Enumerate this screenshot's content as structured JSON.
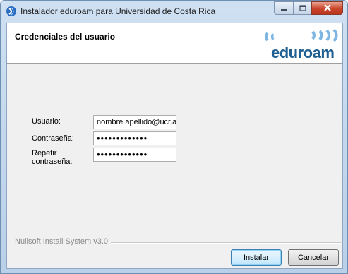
{
  "window": {
    "title": "Instalador eduroam para Universidad de Costa Rica"
  },
  "header": {
    "title": "Credenciales del usuario",
    "logo_text": "eduroam"
  },
  "form": {
    "username_label": "Usuario:",
    "username_value": "nombre.apellido@ucr.a",
    "password_label": "Contraseña:",
    "password_value": "•••••••••••••",
    "repeat_label_line1": "Repetir",
    "repeat_label_line2": "contraseña:",
    "repeat_value": "•••••••••••••"
  },
  "footer": {
    "brand": "Nullsoft Install System v3.0",
    "install_label": "Instalar",
    "cancel_label": "Cancelar"
  },
  "colors": {
    "logo_blue": "#1f5f91",
    "close_red": "#c9452b"
  },
  "icons": [
    "app-icon",
    "minimize-icon",
    "maximize-icon",
    "close-icon",
    "eduroam-logo"
  ]
}
